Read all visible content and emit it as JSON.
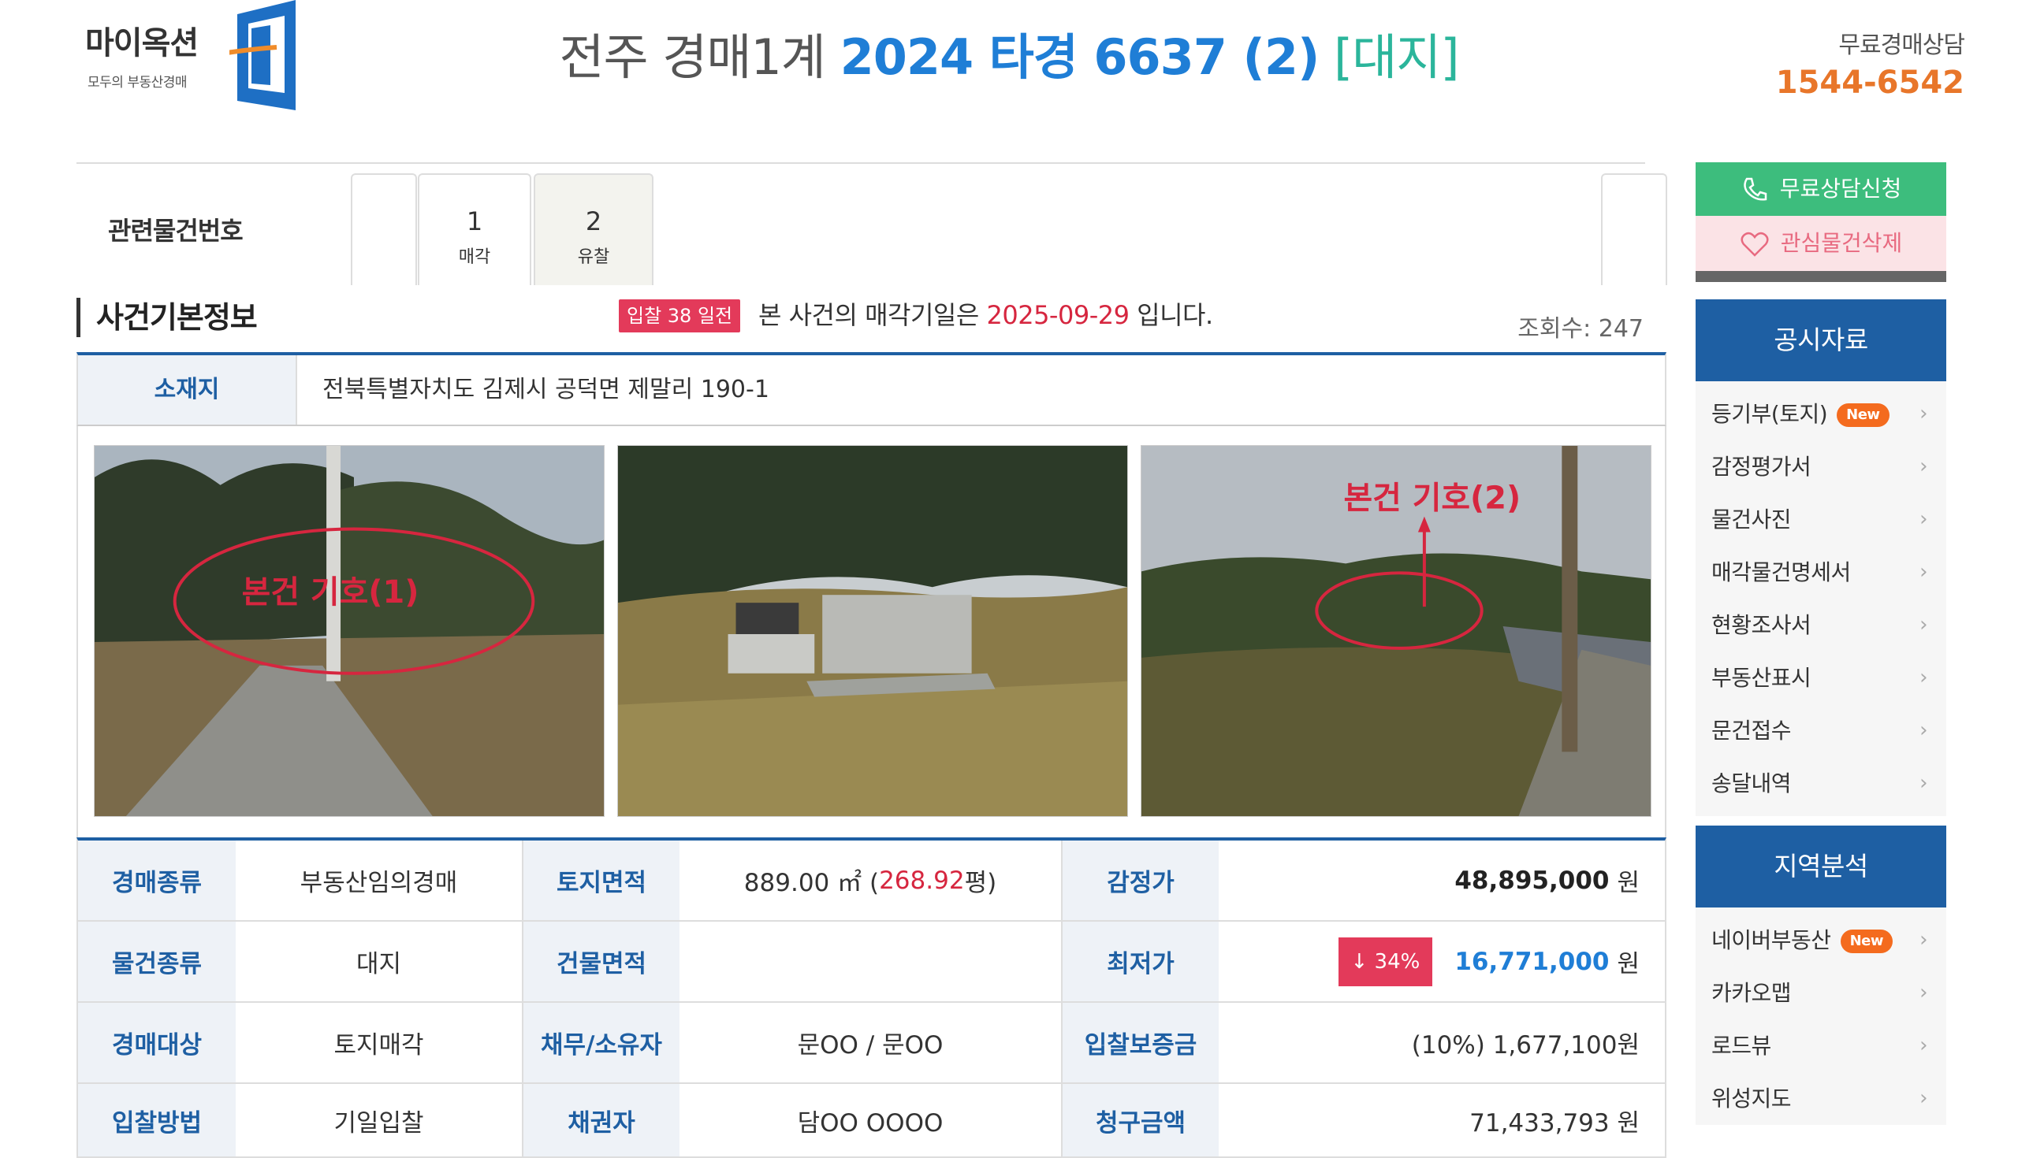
{
  "header": {
    "logo_text": "마이옥션",
    "logo_sub": "모두의 부동산경매",
    "title_court": "전주 경매1계",
    "title_case": "2024 타경 6637 (2)",
    "title_kind": "[대지]",
    "consult_label": "무료경매상담",
    "consult_tel": "1544-6542"
  },
  "related": {
    "label": "관련물건번호",
    "tabs": [
      {
        "num": "1",
        "status": "매각"
      },
      {
        "num": "2",
        "status": "유찰"
      }
    ]
  },
  "section": {
    "title": "사건기본정보",
    "dday": "입찰 38 일전",
    "msg_pre": "본 사건의 매각기일은",
    "sale_date": "2025-09-29",
    "msg_post": "입니다.",
    "views_label": "조회수:",
    "views": "247"
  },
  "address": {
    "label": "소재지",
    "value": "전북특별자치도 김제시 공덕면 제말리 190-1"
  },
  "photos": {
    "p1_label": "본건 기호(1)",
    "p3_label": "본건 기호(2)"
  },
  "info": {
    "rows": [
      {
        "h1": "경매종류",
        "v1": "부동산임의경매",
        "h2": "토지면적",
        "v2_area": "889.00 ㎡ (",
        "v2_pyeong": "268.92",
        "v2_unit": "평)",
        "h3": "감정가",
        "v3": "48,895,000",
        "v3_unit": "원"
      },
      {
        "h1": "물건종류",
        "v1": "대지",
        "h2": "건물면적",
        "v2": "",
        "h3": "최저가",
        "v3_badge": "↓ 34%",
        "v3": "16,771,000",
        "v3_unit": "원"
      },
      {
        "h1": "경매대상",
        "v1": "토지매각",
        "h2": "채무/소유자",
        "v2": "문OO / 문OO",
        "h3": "입찰보증금",
        "v3": "(10%) 1,677,100원"
      },
      {
        "h1": "입찰방법",
        "v1": "기일입찰",
        "h2": "채권자",
        "v2": "담OO OOOO",
        "h3": "청구금액",
        "v3": "71,433,793 원"
      }
    ]
  },
  "sidebar": {
    "consult_button": "무료상담신청",
    "fav_button": "관심물건삭제",
    "notice": {
      "title": "공시자료",
      "items": [
        "등기부(토지)",
        "감정평가서",
        "물건사진",
        "매각물건명세서",
        "현황조사서",
        "부동산표시",
        "문건접수",
        "송달내역"
      ],
      "new_badge": "New"
    },
    "region": {
      "title": "지역분석",
      "items": [
        "네이버부동산",
        "카카오맵",
        "로드뷰",
        "위성지도"
      ],
      "new_badge": "New"
    }
  },
  "colors": {
    "primary_blue": "#1e5fa3",
    "accent_blue": "#1f7ed6",
    "accent_red": "#e33a5a",
    "accent_orange": "#e8762a",
    "green": "#3dbd7d"
  }
}
